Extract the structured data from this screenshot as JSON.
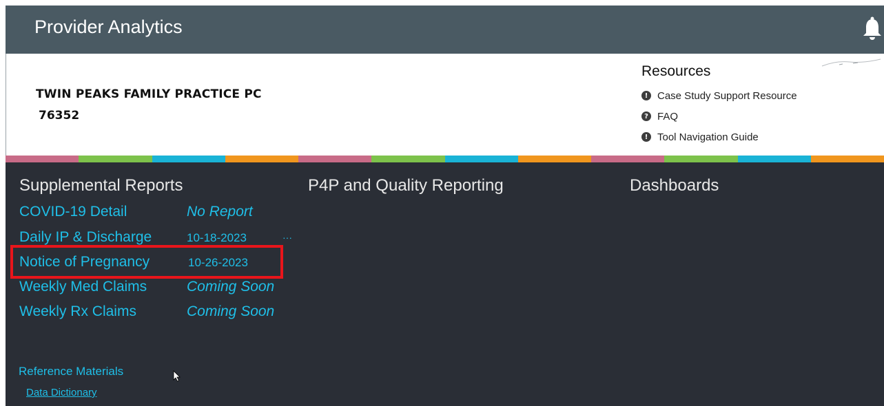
{
  "header": {
    "title": "Provider Analytics",
    "bell_icon": "bell-icon"
  },
  "provider": {
    "name": "TWIN PEAKS FAMILY PRACTICE PC",
    "id": "76352"
  },
  "resources": {
    "heading": "Resources",
    "items": [
      {
        "label": "Case Study Support Resource",
        "icon": "info-icon",
        "glyph": "!"
      },
      {
        "label": "FAQ",
        "icon": "help-icon",
        "glyph": "?"
      },
      {
        "label": "Tool Navigation Guide",
        "icon": "info-icon",
        "glyph": "!"
      }
    ]
  },
  "stripe_colors": [
    "#c86b87",
    "#7dc24b",
    "#1ab3d6",
    "#f0961e",
    "#c86b87",
    "#7dc24b",
    "#1ab3d6",
    "#f0961e",
    "#c86b87",
    "#7dc24b",
    "#1ab3d6",
    "#f0961e"
  ],
  "sections": {
    "supplemental": "Supplemental Reports",
    "p4p": "P4P and Quality Reporting",
    "dashboards": "Dashboards"
  },
  "reports": [
    {
      "name": "COVID-19 Detail",
      "status": "No Report"
    },
    {
      "name": "Daily IP & Discharge",
      "status": "10-18-2023"
    },
    {
      "name": "Notice of Pregnancy",
      "status": "10-26-2023"
    },
    {
      "name": "Weekly Med Claims",
      "status": "Coming Soon"
    },
    {
      "name": "Weekly Rx Claims",
      "status": "Coming Soon"
    }
  ],
  "reference": {
    "heading": "Reference Materials",
    "link": "Data Dictionary"
  },
  "colors": {
    "header_bg": "#4a5a63",
    "content_bg": "#2a2e36",
    "link": "#1fbfe8",
    "highlight": "#e8151b"
  }
}
